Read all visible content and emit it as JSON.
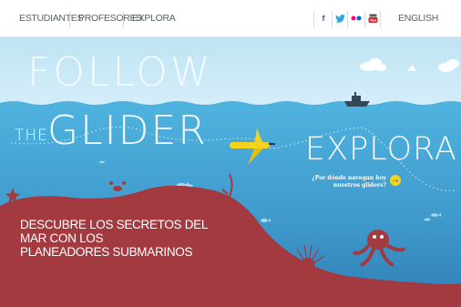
{
  "nav": {
    "items": [
      {
        "label": "ESTUDIANTES"
      },
      {
        "label": "PROFESORES"
      },
      {
        "label": "EXPLORA"
      }
    ],
    "language_label": "ENGLISH",
    "social_icons": [
      "facebook-icon",
      "twitter-icon",
      "flickr-icon",
      "youtube-icon"
    ]
  },
  "hero": {
    "title_line1": "FOLLOW",
    "title_prefix": "THE",
    "title_line2": "GLIDER",
    "headline_lines": [
      "DESCUBRE LOS SECRETOS DEL",
      "MAR CON LOS",
      "PLANEADORES SUBMARINOS"
    ]
  },
  "cta": {
    "title": "EXPLORA",
    "question_line1": "¿Por dónde navegan hoy",
    "question_line2": "nuestros gliders?",
    "arrow_icon": "arrow-right-icon"
  },
  "colors": {
    "sky": "#c9e8f5",
    "ocean_top": "#55b7e0",
    "ocean_bottom": "#2b7fb4",
    "seabed": "#a23a40",
    "glider": "#f4d31f",
    "nav_text": "#5d6168"
  }
}
